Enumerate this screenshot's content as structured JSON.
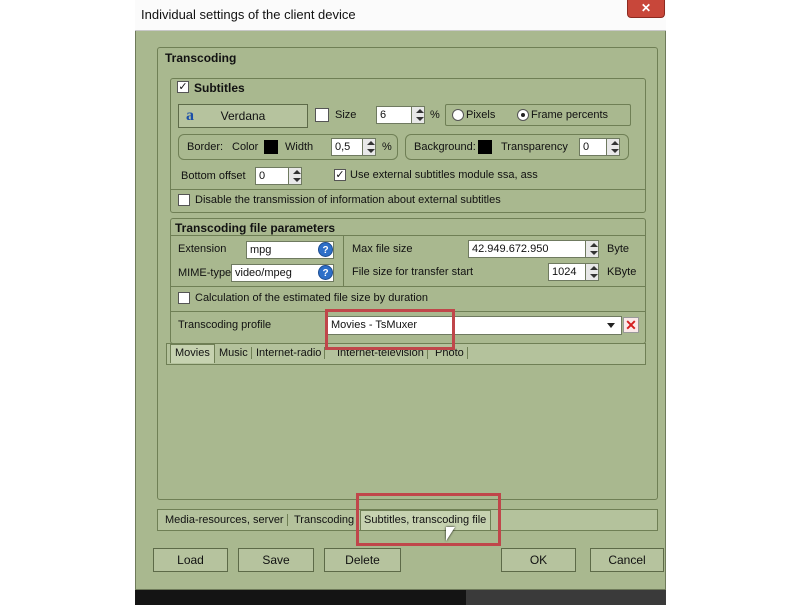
{
  "window": {
    "title": "Individual settings of the client device",
    "close_glyph": "✕"
  },
  "transcoding": {
    "header": "Transcoding",
    "subtitles": {
      "header": "Subtitles",
      "checked": true,
      "font_icon": "a",
      "font_button": "Verdana",
      "size_label": "Size",
      "size_value": "6",
      "size_unit": "%",
      "size_checked": false,
      "pixels_label": "Pixels",
      "frame_percents_label": "Frame percents",
      "selected_unit": "Frame percents",
      "border_label": "Border:",
      "color_label": "Color",
      "width_label": "Width",
      "width_value": "0,5",
      "width_unit": "%",
      "background_label": "Background:",
      "transparency_label": "Transparency",
      "transparency_value": "0",
      "bottom_offset_label": "Bottom offset",
      "bottom_offset_value": "0",
      "external_module_label": "Use external subtitles module ssa, ass",
      "external_module_checked": true,
      "disable_transmission_label": "Disable the transmission of information about external subtitles",
      "disable_transmission_checked": false
    },
    "file_params": {
      "header": "Transcoding file parameters",
      "extension_label": "Extension",
      "extension_value": "mpg",
      "mime_label": "MIME-type",
      "mime_value": "video/mpeg",
      "max_size_label": "Max file size",
      "max_size_value": "42.949.672.950",
      "max_size_unit": "Byte",
      "start_size_label": "File size for transfer start",
      "start_size_value": "1024",
      "start_size_unit": "KByte",
      "estimate_label": "Calculation of the estimated file size by duration",
      "estimate_checked": false,
      "profile_label": "Transcoding profile",
      "profile_value": "Movies - TsMuxer"
    },
    "media_tabs": [
      "Movies",
      "Music",
      "Internet-radio",
      "Internet-television",
      "Photo"
    ]
  },
  "bottom_tabs": [
    "Media-resources, server",
    "Transcoding",
    "Subtitles, transcoding file"
  ],
  "buttons": {
    "load": "Load",
    "save": "Save",
    "delete": "Delete",
    "ok": "OK",
    "cancel": "Cancel"
  },
  "colors": {
    "dialog_bg": "#a9b88f",
    "highlight": "#c0464a",
    "help": "#2d6fc8"
  }
}
